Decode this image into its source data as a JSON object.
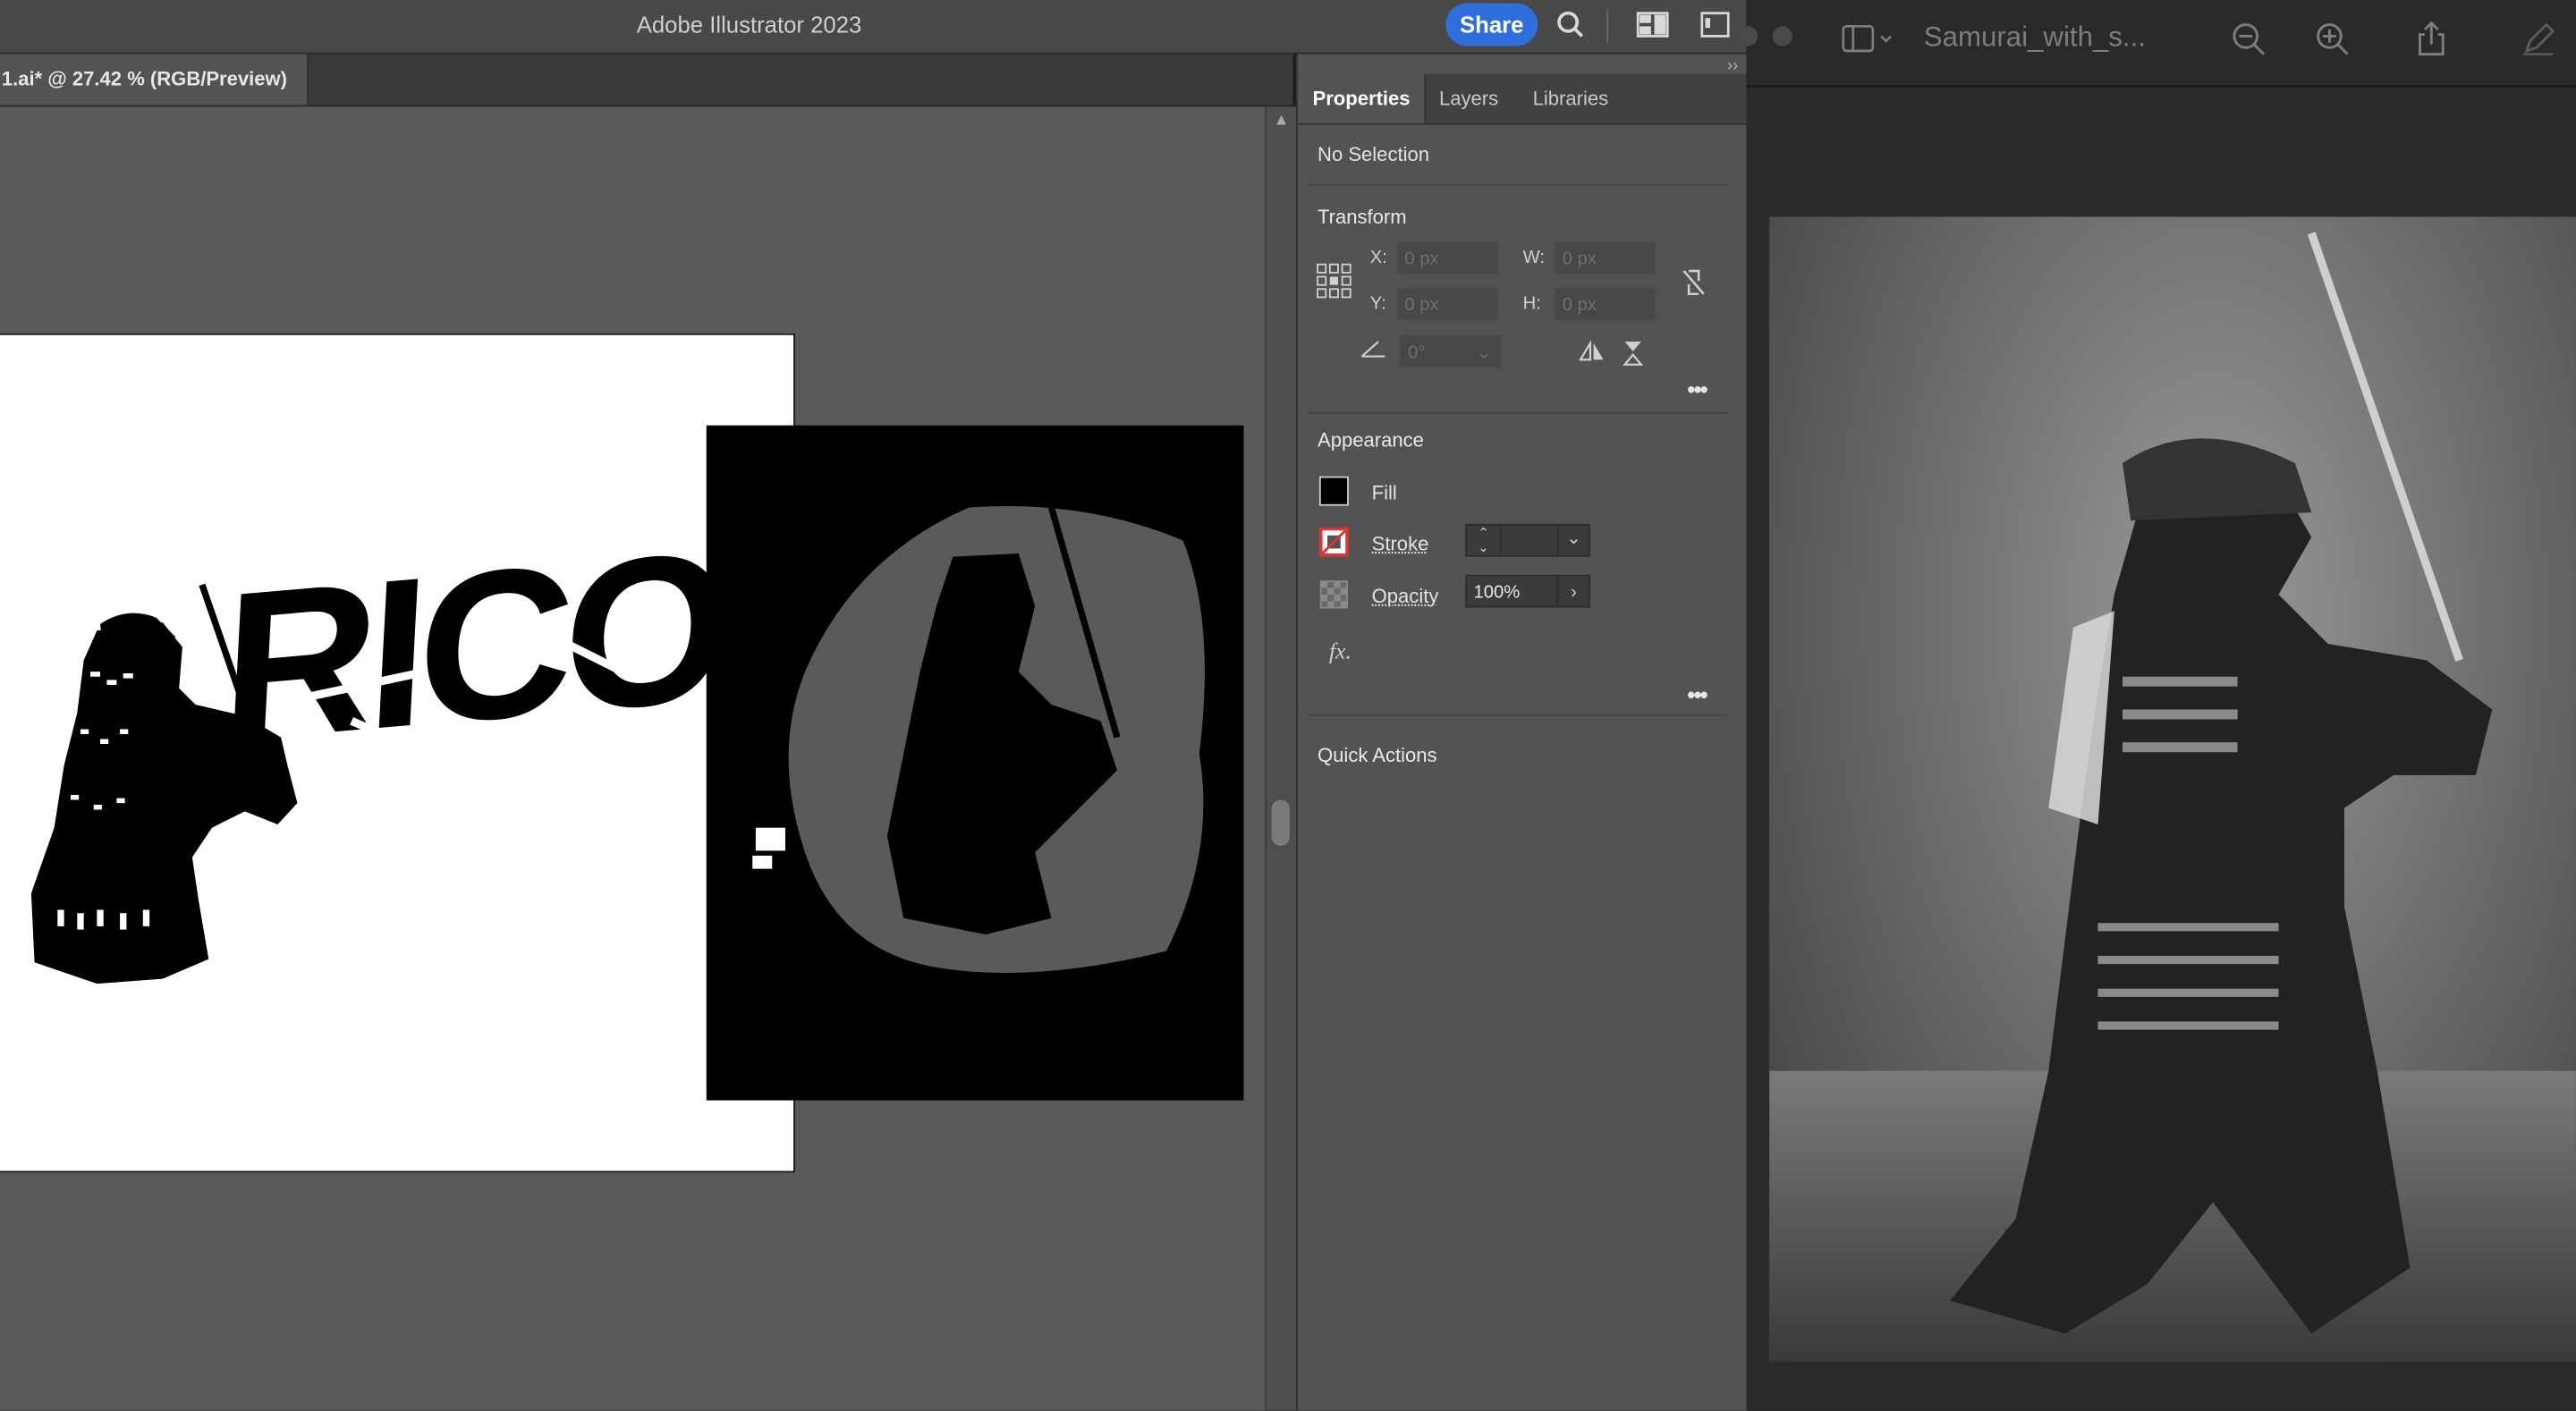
{
  "illustrator": {
    "window_title": "Adobe Illustrator 2023",
    "share_label": "Share",
    "doc_tab": "1.ai* @ 27.42 % (RGB/Preview)",
    "artwork_text": "RICO"
  },
  "properties": {
    "tabs": [
      "Properties",
      "Layers",
      "Libraries"
    ],
    "selection": "No Selection",
    "transform": {
      "heading": "Transform",
      "x_label": "X:",
      "x_value": "0 px",
      "y_label": "Y:",
      "y_value": "0 px",
      "w_label": "W:",
      "w_value": "0 px",
      "h_label": "H:",
      "h_value": "0 px",
      "angle_value": "0°"
    },
    "appearance": {
      "heading": "Appearance",
      "fill_label": "Fill",
      "stroke_label": "Stroke",
      "opacity_label": "Opacity",
      "opacity_value": "100%",
      "fx_label": "fx."
    },
    "quick_actions": "Quick Actions"
  },
  "preview": {
    "title": "Samurai_with_s..."
  },
  "colors": {
    "accent": "#2f6fdc",
    "panel_bg": "#535353",
    "canvas_bg": "#5a5a5a"
  }
}
